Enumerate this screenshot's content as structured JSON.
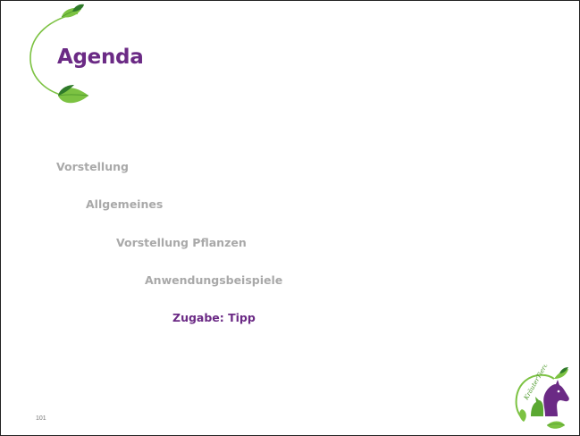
{
  "slide": {
    "title": "Agenda",
    "agenda_items": [
      {
        "label": "Vorstellung",
        "state": "inactive"
      },
      {
        "label": "Allgemeines",
        "state": "inactive"
      },
      {
        "label": "Vorstellung Pflanzen",
        "state": "inactive"
      },
      {
        "label": "Anwendungsbeispiele",
        "state": "inactive"
      },
      {
        "label": "Zugabe: Tipp",
        "state": "active"
      }
    ],
    "page_number": "101",
    "logo_text": "KräuterTierchen"
  },
  "colors": {
    "title": "#6b2a85",
    "active_item": "#6b2a85",
    "inactive_item": "#a9a9a9",
    "leaf_green": "#7cc242",
    "dark_green": "#2f7a2a",
    "horse_purple": "#6b2a85"
  },
  "icons": [
    "vine-leaf-icon",
    "horse-logo-icon"
  ]
}
